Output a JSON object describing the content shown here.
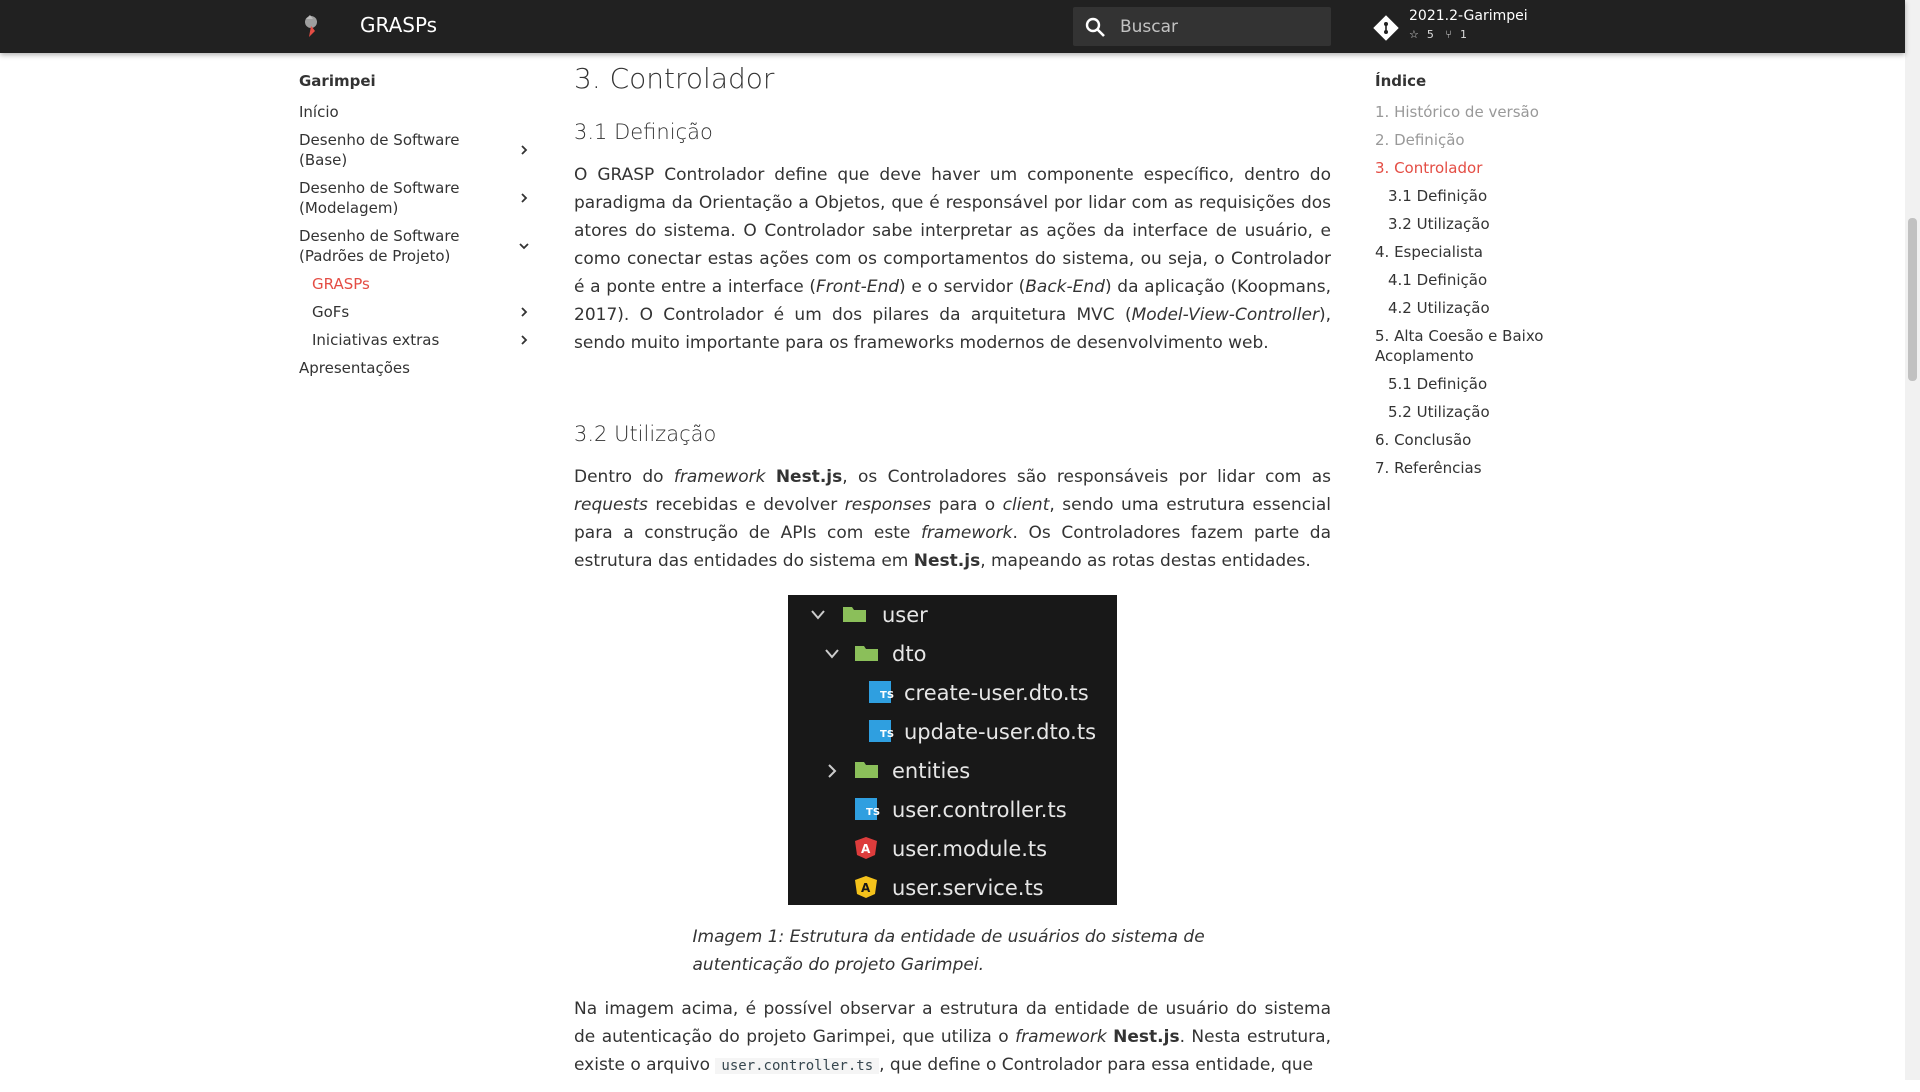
{
  "header": {
    "site_title": "GRASPs",
    "search_placeholder": "Buscar",
    "repo_name": "2021.2-Garimpei",
    "repo_stars": "5",
    "repo_forks": "1"
  },
  "nav": {
    "title": "Garimpei",
    "items": [
      {
        "label": "Início"
      },
      {
        "label": "Desenho de Software (Base)"
      },
      {
        "label": "Desenho de Software (Modelagem)"
      },
      {
        "label": "Desenho de Software (Padrões de Projeto)"
      },
      {
        "label": "GRASPs"
      },
      {
        "label": "GoFs"
      },
      {
        "label": "Iniciativas extras"
      },
      {
        "label": "Apresentações"
      }
    ]
  },
  "toc": {
    "title": "Índice",
    "items": [
      {
        "label": "1. Histórico de versão"
      },
      {
        "label": "2. Definição"
      },
      {
        "label": "3. Controlador"
      },
      {
        "label": "3.1 Definição"
      },
      {
        "label": "3.2 Utilização"
      },
      {
        "label": "4. Especialista"
      },
      {
        "label": "4.1 Definição"
      },
      {
        "label": "4.2 Utilização"
      },
      {
        "label": "5. Alta Coesão e Baixo Acoplamento"
      },
      {
        "label": "5.1 Definição"
      },
      {
        "label": "5.2 Utilização"
      },
      {
        "label": "6. Conclusão"
      },
      {
        "label": "7. Referências"
      }
    ]
  },
  "content": {
    "h1": "3. Controlador",
    "h2_def": "3.1 Definição",
    "p1": {
      "a": "O GRASP Controlador define que deve haver um componente específico, dentro do paradigma da Orientação a Objetos, que é responsável por lidar com as requisições dos atores do sistema. O Controlador sabe interpretar as ações da interface de usuário, e como conectar estas ações com os comportamentos do sistema, ou seja, o Controlador é a ponte entre a interface (",
      "front_end": "Front-End",
      "b": ") e o servidor (",
      "back_end": "Back-End",
      "c": ") da aplicação (Koopmans, 2017). O Controlador é um dos pilares da arquitetura MVC (",
      "mvc": "Model-View-Controller",
      "d": "), sendo muito importante para os frameworks modernos de desenvolvimento web."
    },
    "h2_use": "3.2 Utilização",
    "p2": {
      "a": "Dentro do ",
      "framework1": "framework",
      "nest1": "Nest.js",
      "b": ", os Controladores são responsáveis por lidar com as ",
      "requests": "requests",
      "c": " recebidas e devolver ",
      "responses": "responses",
      "d": " para o ",
      "client": "client",
      "e": ", sendo uma estrutura essencial para a construção de APIs com este ",
      "framework2": "framework",
      "f": ". Os Controladores fazem parte da estrutura das entidades do sistema em ",
      "nest2": "Nest.js",
      "g": ", mapeando as rotas destas entidades."
    },
    "figure": {
      "rows": [
        {
          "label": "user"
        },
        {
          "label": "dto"
        },
        {
          "label": "create-user.dto.ts"
        },
        {
          "label": "update-user.dto.ts"
        },
        {
          "label": "entities"
        },
        {
          "label": "user.controller.ts"
        },
        {
          "label": "user.module.ts"
        },
        {
          "label": "user.service.ts"
        }
      ],
      "caption": "Imagem 1: Estrutura da entidade de usuários do sistema de autenticação do projeto Garimpei."
    },
    "p3": {
      "a": "Na imagem acima, é possível observar a estrutura da entidade de usuário do sistema de autenticação do projeto Garimpei, que utiliza o ",
      "framework": "framework",
      "nest": "Nest.js",
      "b": ". Nesta estrutura, existe o arquivo ",
      "code": "user.controller.ts",
      "c": ", que define o Controlador para essa entidade, que"
    }
  },
  "colors": {
    "header_bg": "#212121",
    "accent": "#e44d44",
    "figure_bg": "#181818",
    "ts_blue": "#2f9fe0",
    "angular_red": "#dd3c3c",
    "angular_yellow": "#f4c21b",
    "folder_green": "#8bbf5a"
  }
}
